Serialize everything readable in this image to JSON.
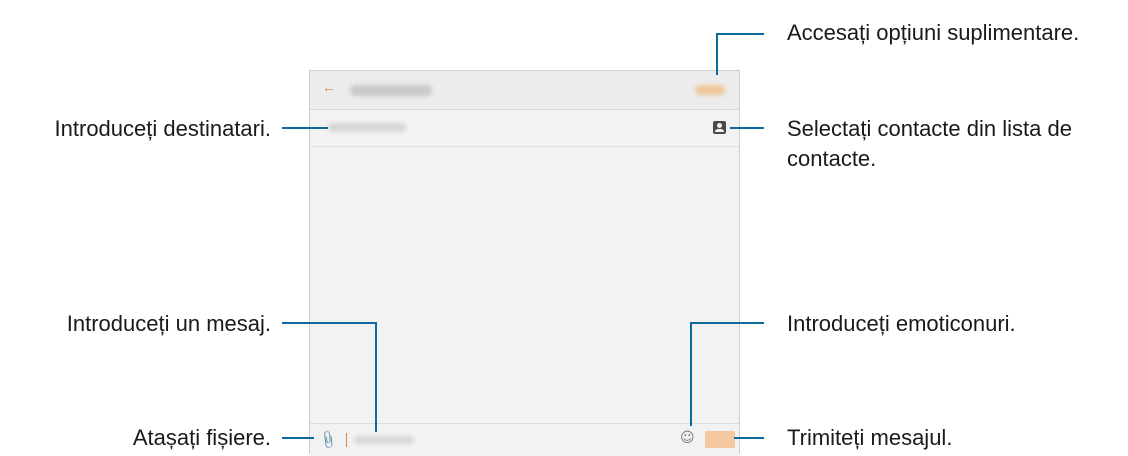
{
  "annotations": {
    "more_options": "Accesați opțiuni suplimentare.",
    "enter_recipients": "Introduceți destinatari.",
    "select_contacts_line1": "Selectați contacte din lista de",
    "select_contacts_line2": "contacte.",
    "enter_message": "Introduceți un mesaj.",
    "enter_emoticons": "Introduceți emoticonuri.",
    "attach_files": "Atașați fișiere.",
    "send_message": "Trimiteți mesajul."
  },
  "phone": {
    "icons": {
      "back": "back-arrow-icon",
      "contacts": "contact-card-icon",
      "attach": "paperclip-icon",
      "emoji": "smiley-icon"
    },
    "colors": {
      "accent": "#e58a3a",
      "send_button": "#f3c8a0",
      "callout_line": "#0d6a9e"
    }
  }
}
